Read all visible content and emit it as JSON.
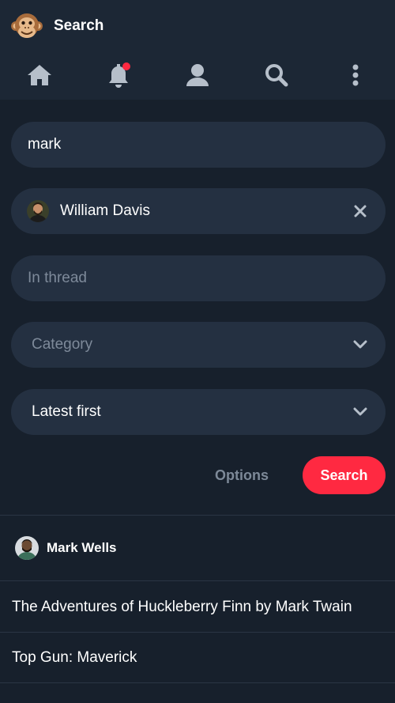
{
  "header": {
    "title": "Search",
    "logo_icon": "monkey-face-icon"
  },
  "nav": {
    "items": [
      {
        "name": "home",
        "icon": "home-icon"
      },
      {
        "name": "notifications",
        "icon": "bell-icon",
        "has_unread": true
      },
      {
        "name": "profile",
        "icon": "user-icon"
      },
      {
        "name": "search",
        "icon": "search-icon"
      },
      {
        "name": "more",
        "icon": "kebab-menu-icon"
      }
    ]
  },
  "form": {
    "query_value": "mark",
    "author_chip": {
      "name": "William Davis",
      "clear_icon": "close-icon"
    },
    "thread_placeholder": "In thread",
    "category_placeholder": "Category",
    "sort_value": "Latest first",
    "options_label": "Options",
    "search_label": "Search"
  },
  "results": {
    "users": [
      {
        "name": "Mark Wells"
      }
    ],
    "threads": [
      {
        "title": "The Adventures of Huckleberry Finn by Mark Twain"
      },
      {
        "title": "Top Gun: Maverick"
      }
    ]
  },
  "colors": {
    "background": "#17202c",
    "header": "#1c2735",
    "field": "#243041",
    "accent": "#ff2941",
    "muted": "#7e8a9a"
  }
}
